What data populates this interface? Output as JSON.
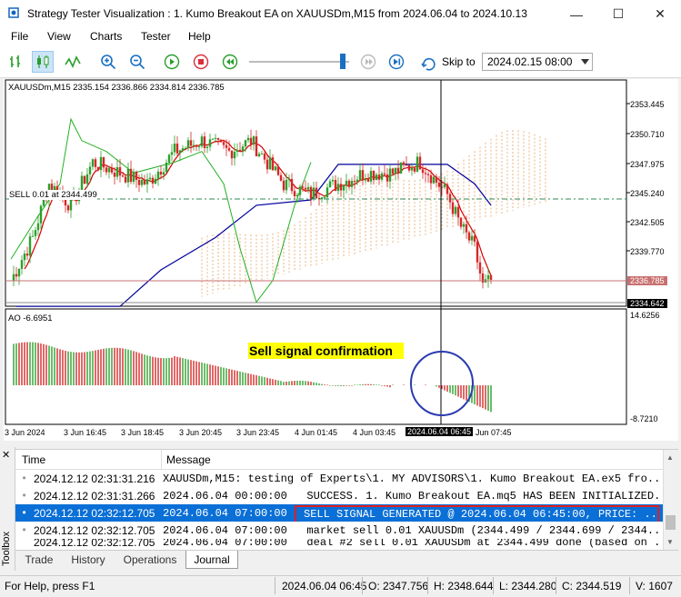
{
  "window": {
    "title": "Strategy Tester Visualization : 1. Kumo Breakout EA on XAUUSDm,M15 from 2024.06.04 to 2024.10.13",
    "minimize": "—",
    "maximize": "☐",
    "close": "✕"
  },
  "menu": [
    "File",
    "View",
    "Charts",
    "Tester",
    "Help"
  ],
  "toolbar": {
    "skip_label": "Skip to",
    "skip_value": "2024.02.15 08:00",
    "slider_level": 0.96
  },
  "chart": {
    "header": "XAUUSDm,M15  2335.154 2336.866 2334.814 2336.785",
    "sell_line_label": "SELL 0.01 at 2344.499",
    "price_axis": [
      "2353.445",
      "2350.710",
      "2347.975",
      "2345.240",
      "2342.505",
      "2339.770"
    ],
    "price_tag_current": "2336.785",
    "price_tag_low": "2334.642",
    "ao_label": "AO -6.6951",
    "ao_axis_top": "14.6256",
    "ao_axis_bottom": "-8.7210",
    "annotation": "Sell signal confirmation",
    "time_axis": [
      "3 Jun 2024",
      "3 Jun 16:45",
      "3 Jun 18:45",
      "3 Jun 20:45",
      "3 Jun 23:45",
      "4 Jun 01:45",
      "4 Jun 03:45",
      "2024.06.04 06:45",
      "Jun 07:45"
    ],
    "colors": {
      "bull": "#2ca02c",
      "bear": "#d62728",
      "tenkan": "#d40000",
      "kijun": "#00009c",
      "chikou": "#22b022",
      "cloud": "#e8a060",
      "sell_line": "#2e8b57",
      "annotation_bg": "#ffff00",
      "circle": "#2b3bb0"
    }
  },
  "terminal": {
    "columns": [
      "Time",
      "Message"
    ],
    "rows": [
      {
        "time": "2024.12.12 02:31:31.216",
        "message": "XAUUSDm,M15: testing of Experts\\1. MY ADVISORS\\1. Kumo Breakout EA.ex5 fro..."
      },
      {
        "time": "2024.12.12 02:31:31.266",
        "message": "2024.06.04 00:00:00   SUCCESS. 1. Kumo Breakout EA.mq5 HAS BEEN INITIALIZED."
      },
      {
        "time": "2024.12.12 02:32:12.705",
        "message_prefix": "2024.06.04 07:00:00",
        "message_highlight": "SELL SIGNAL GENERATED @ 2024.06.04 06:45:00, PRICE: ..."
      },
      {
        "time": "2024.12.12 02:32:12.705",
        "message": "2024.06.04 07:00:00   market sell 0.01 XAUUSDm (2344.499 / 2344.699 / 2344..."
      },
      {
        "time": "2024.12.12 02:32:12.705",
        "message": "2024.06.04 07:00:00   deal #2 sell 0.01 XAUUSDm at 2344.499 done (based on ..."
      }
    ],
    "tabs": [
      "Trade",
      "History",
      "Operations",
      "Journal"
    ],
    "active_tab": "Journal",
    "side_label": "Toolbox"
  },
  "status": {
    "help": "For Help, press F1",
    "datetime": "2024.06.04 06:45",
    "open": "O: 2347.756",
    "high": "H: 2348.644",
    "low": "L: 2344.280",
    "close": "C: 2344.519",
    "volume": "V: 1607"
  }
}
